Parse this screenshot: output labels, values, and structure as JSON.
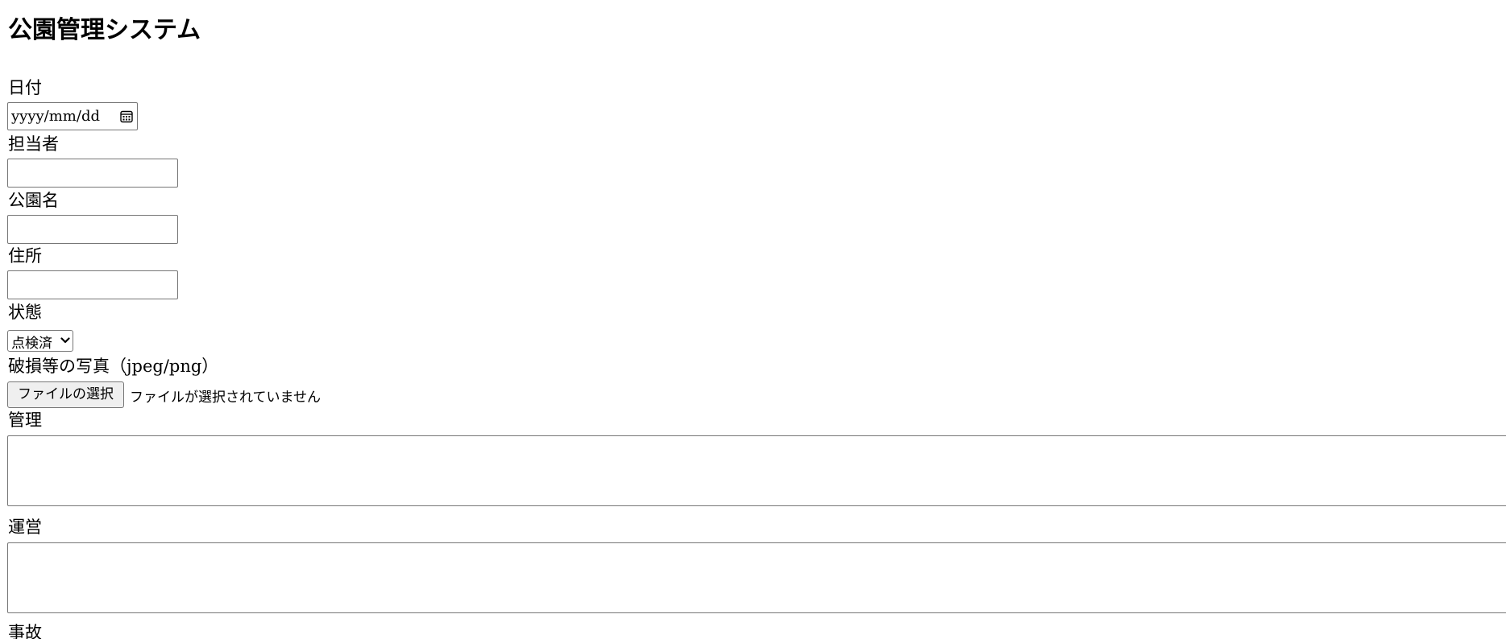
{
  "app": {
    "title": "公園管理システム"
  },
  "form": {
    "date": {
      "label": "日付",
      "placeholder": "yyyy/mm/dd",
      "icon": "calendar-icon"
    },
    "person_in_charge": {
      "label": "担当者",
      "value": ""
    },
    "park_name": {
      "label": "公園名",
      "value": ""
    },
    "address": {
      "label": "住所",
      "value": ""
    },
    "status": {
      "label": "状態",
      "selected": "点検済",
      "icon": "chevron-down-icon"
    },
    "photo": {
      "label": "破損等の写真（jpeg/png）",
      "button_label": "ファイルの選択",
      "status_text": "ファイルが選択されていません"
    },
    "management": {
      "label": "管理",
      "value": ""
    },
    "operation": {
      "label": "運営",
      "value": ""
    },
    "accident": {
      "label": "事故"
    }
  }
}
